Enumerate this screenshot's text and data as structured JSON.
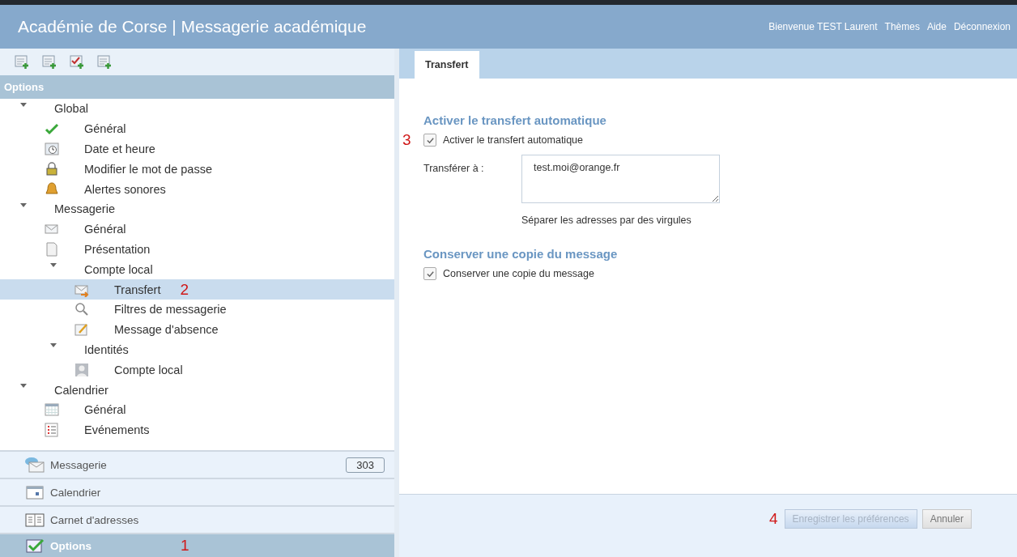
{
  "header": {
    "title": "Académie de Corse | Messagerie académique",
    "links": [
      "Bienvenue TEST Laurent",
      "Thèmes",
      "Aide",
      "Déconnexion"
    ]
  },
  "options_panel": {
    "title": "Options",
    "tree": [
      {
        "label": "Global",
        "expanded": true,
        "children": [
          {
            "label": "Général",
            "selected": false
          },
          {
            "label": "Date et heure",
            "selected": false
          },
          {
            "label": "Modifier le mot de passe",
            "selected": false
          },
          {
            "label": "Alertes sonores",
            "selected": false
          }
        ]
      },
      {
        "label": "Messagerie",
        "expanded": true,
        "children": [
          {
            "label": "Général",
            "selected": false
          },
          {
            "label": "Présentation",
            "selected": false
          },
          {
            "label": "Compte local",
            "expanded": true,
            "children": [
              {
                "label": "Transfert",
                "selected": true,
                "marker": "2"
              },
              {
                "label": "Filtres de messagerie",
                "selected": false
              },
              {
                "label": "Message d'absence",
                "selected": false
              }
            ]
          },
          {
            "label": "Identités",
            "expanded": true,
            "children": [
              {
                "label": "Compte local",
                "selected": false
              }
            ]
          }
        ]
      },
      {
        "label": "Calendrier",
        "expanded": true,
        "children": [
          {
            "label": "Général",
            "selected": false
          },
          {
            "label": "Evénements",
            "selected": false
          }
        ]
      }
    ]
  },
  "nav": [
    {
      "label": "Messagerie",
      "count": "303",
      "selected": false
    },
    {
      "label": "Calendrier",
      "selected": false
    },
    {
      "label": "Carnet d'adresses",
      "selected": false
    },
    {
      "label": "Options",
      "selected": true,
      "marker": "1"
    }
  ],
  "tabs": [
    {
      "label": "Transfert",
      "selected": true
    }
  ],
  "sections": [
    {
      "heading": "Activer le transfert automatique",
      "checkbox": {
        "label": "Activer le transfert automatique",
        "checked": true,
        "marker": "3"
      },
      "field": {
        "label": "Transférer à :",
        "value": "test.moi@orange.fr",
        "hint": "Séparer les adresses par des virgules"
      }
    },
    {
      "heading": "Conserver une copie du message",
      "checkbox": {
        "label": "Conserver une copie du message",
        "checked": true
      }
    }
  ],
  "buttons": [
    {
      "label": "Enregistrer les préférences",
      "disabled": true,
      "marker": "4"
    },
    {
      "label": "Annuler",
      "disabled": false
    }
  ]
}
